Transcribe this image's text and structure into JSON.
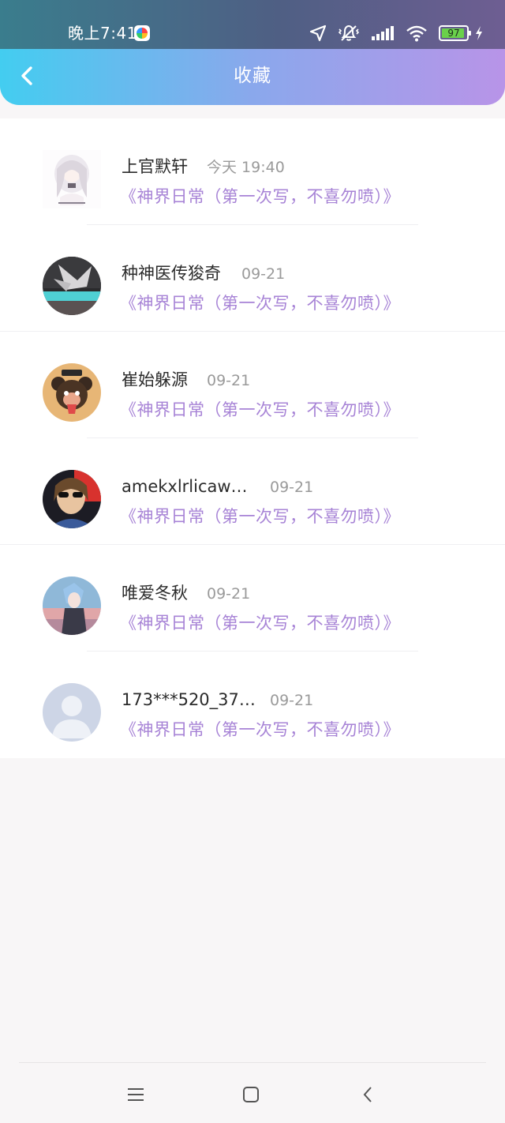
{
  "status_bar": {
    "time": "晚上7:41",
    "battery_level": "97",
    "battery_color": "#6ad04b",
    "icons": [
      "location-arrow-icon",
      "vibrate-mute-icon",
      "signal-bars-icon",
      "wifi-icon",
      "battery-icon",
      "charging-bolt-icon"
    ]
  },
  "header": {
    "title": "收藏",
    "back_icon": "chevron-left-icon",
    "gradient": [
      "#43cdf0",
      "#8aa8ec",
      "#b894e8"
    ]
  },
  "list": {
    "items": [
      {
        "user": "上官默轩",
        "time": "今天 19:40",
        "title": "《神界日常（第一次写，不喜勿喷）》",
        "avatar": "anime-girl-avatar"
      },
      {
        "user": "种神医传狻奇",
        "time": "09-21",
        "title": "《神界日常（第一次写，不喜勿喷）》",
        "avatar": "hand-photo-avatar"
      },
      {
        "user": "崔始躲源",
        "time": "09-21",
        "title": "《神界日常（第一次写，不喜勿喷）》",
        "avatar": "cartoon-bear-avatar"
      },
      {
        "user": "amekxlrlicaw…",
        "time": "09-21",
        "title": "《神界日常（第一次写，不喜勿喷）》",
        "avatar": "sunglasses-person-avatar"
      },
      {
        "user": "唯爱冬秋",
        "time": "09-21",
        "title": "《神界日常（第一次写，不喜勿喷）》",
        "avatar": "anime-boy-avatar"
      },
      {
        "user": "173***520_37…",
        "time": "09-21",
        "title": "《神界日常（第一次写，不喜勿喷）》",
        "avatar": "default-person-avatar"
      }
    ],
    "title_color": "#a783d6"
  },
  "nav_bar": {
    "buttons": [
      "menu-icon",
      "home-square-icon",
      "back-arrow-icon"
    ]
  }
}
